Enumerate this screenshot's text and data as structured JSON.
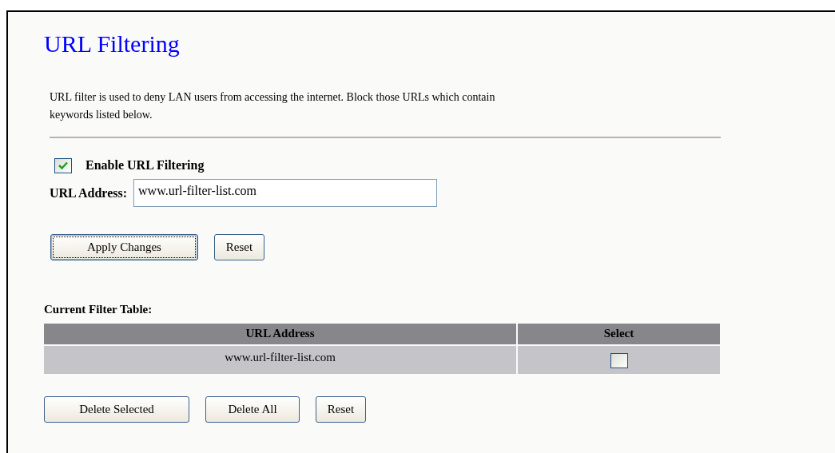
{
  "title": "URL Filtering",
  "description": "URL filter is used to deny LAN users from accessing the internet. Block those URLs which contain keywords listed below.",
  "enable": {
    "label": "Enable URL Filtering",
    "checked": true
  },
  "url_field": {
    "label": "URL Address:",
    "value": "www.url-filter-list.com"
  },
  "form_buttons": [
    {
      "label": "Apply Changes",
      "focused": true
    },
    {
      "label": "Reset",
      "focused": false
    }
  ],
  "table": {
    "title": "Current Filter Table:",
    "columns": [
      "URL Address",
      "Select"
    ],
    "rows": [
      {
        "url": "www.url-filter-list.com",
        "selected": false
      }
    ]
  },
  "table_buttons": [
    "Delete Selected",
    "Delete All",
    "Reset"
  ]
}
